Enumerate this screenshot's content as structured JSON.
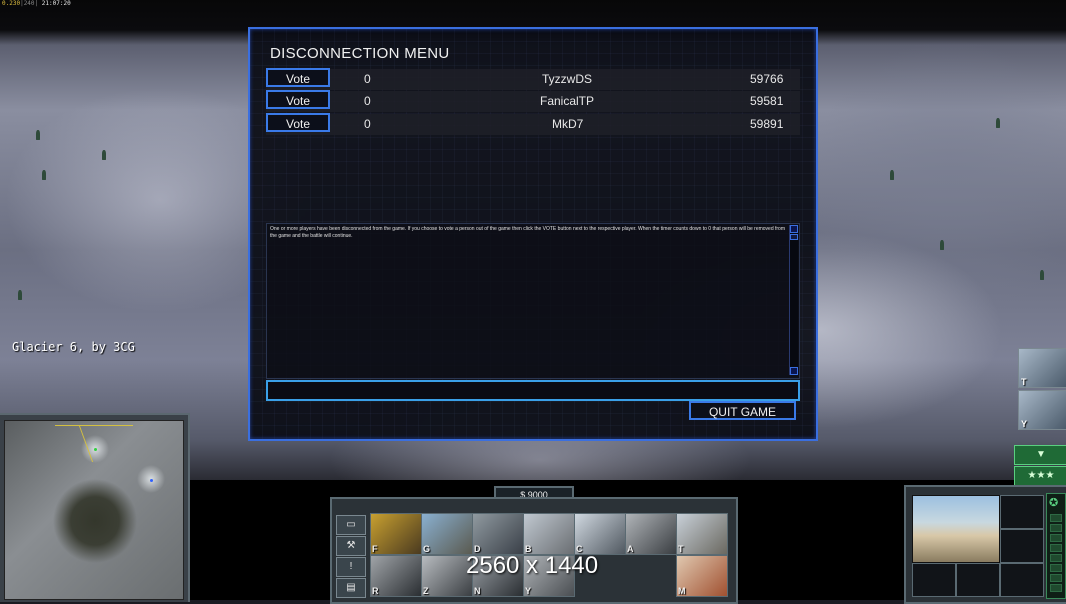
{
  "hud_top": {
    "fps": "0.230",
    "fps_alt": "240",
    "clock": "21:07:20"
  },
  "map_label": "Glacier 6, by 3CG",
  "dialog": {
    "title": "DISCONNECTION MENU",
    "players": [
      {
        "vote_label": "Vote",
        "votes": "0",
        "name": "TyzzwDS",
        "timer": "59766"
      },
      {
        "vote_label": "Vote",
        "votes": "0",
        "name": "FanicalTP",
        "timer": "59581"
      },
      {
        "vote_label": "Vote",
        "votes": "0",
        "name": "MkD7",
        "timer": "59891"
      }
    ],
    "message": "One or more players have been disconnected from the game. If you choose to vote a person out of the game then click the VOTE button next to the respective player. When the timer counts down to 0 that person will be removed from the game and the battle will continue.",
    "chat_value": "",
    "quit_label": "QUIT GAME"
  },
  "hud_bottom": {
    "money": "$ 9000",
    "resolution_overlay": "2560 x 1440",
    "build_slots_row1": [
      {
        "key": "F",
        "icon": "war-factory-icon"
      },
      {
        "key": "G",
        "icon": "barracks-icon"
      },
      {
        "key": "D",
        "icon": "airfield-icon"
      },
      {
        "key": "B",
        "icon": "patriot-battery-icon"
      },
      {
        "key": "C",
        "icon": "supply-center-icon"
      },
      {
        "key": "A",
        "icon": "strategy-center-icon"
      },
      {
        "key": "T",
        "icon": "detention-camp-icon"
      }
    ],
    "build_slots_row2": [
      {
        "key": "R",
        "icon": "power-plant-icon"
      },
      {
        "key": "Z",
        "icon": "command-center-icon"
      },
      {
        "key": "N",
        "icon": "fire-base-icon"
      },
      {
        "key": "Y",
        "icon": "supply-drop-icon"
      },
      {
        "key": "M",
        "icon": "radar-icon"
      }
    ],
    "tray_slots": [
      {
        "key": "T",
        "icon": "satellite-icon"
      },
      {
        "key": "Y",
        "icon": "drone-icon"
      }
    ],
    "colors": {
      "dialog_border": "#3a6fe0",
      "chat_border": "#3aa0e8",
      "general_button": "#1f6a36"
    }
  }
}
